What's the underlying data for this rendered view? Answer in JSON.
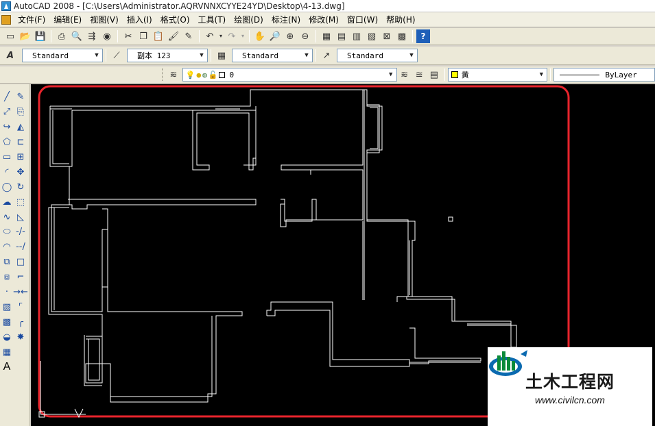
{
  "window": {
    "title": "AutoCAD 2008 - [C:\\Users\\Administrator.AQRVNNXCYYE24YD\\Desktop\\4-13.dwg]"
  },
  "menu": {
    "items": [
      {
        "label": "文件(F)"
      },
      {
        "label": "编辑(E)"
      },
      {
        "label": "视图(V)"
      },
      {
        "label": "插入(I)"
      },
      {
        "label": "格式(O)"
      },
      {
        "label": "工具(T)"
      },
      {
        "label": "绘图(D)"
      },
      {
        "label": "标注(N)"
      },
      {
        "label": "修改(M)"
      },
      {
        "label": "窗口(W)"
      },
      {
        "label": "帮助(H)"
      }
    ]
  },
  "styles_toolbar": {
    "text_style": "Standard",
    "dim_style": "副本 123",
    "table_style": "Standard",
    "multileader_style": "Standard"
  },
  "layers_toolbar": {
    "current_layer": "0",
    "color": "黄",
    "color_hex": "#ffff00",
    "linetype": "ByLayer"
  },
  "watermark": {
    "title": "土木工程网",
    "url": "www.civilcn.com"
  },
  "colors": {
    "highlight_frame": "#e8242c",
    "drawing_lines": "#ffffff",
    "canvas_bg": "#000000"
  }
}
